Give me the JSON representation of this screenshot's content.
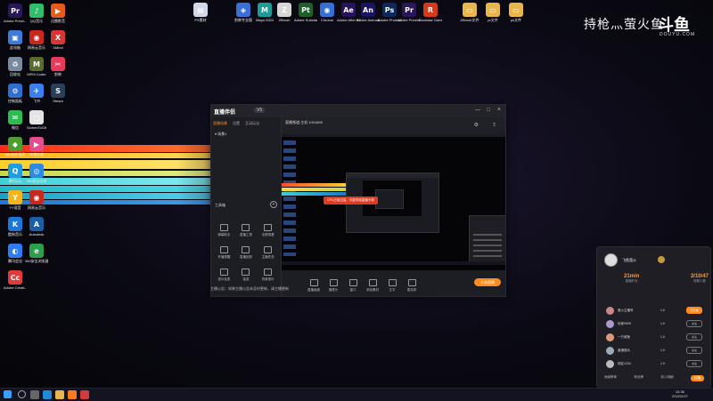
{
  "desktop_icons": [
    {
      "label": "Adobe Premi...",
      "color": "#2a1757",
      "glyph": "Pr"
    },
    {
      "label": "QQ音乐",
      "color": "#2fbf6a",
      "glyph": "♪"
    },
    {
      "label": "迅雷影音",
      "color": "#e85a1a",
      "glyph": "▶"
    },
    {
      "label": "此电脑",
      "color": "#3e7ad8",
      "glyph": "▣"
    },
    {
      "label": "网易云音乐",
      "color": "#c9281e",
      "glyph": "◉"
    },
    {
      "label": "XMind",
      "color": "#d83535",
      "glyph": "X"
    },
    {
      "label": "回收站",
      "color": "#7a8aa0",
      "glyph": "♻"
    },
    {
      "label": "MPM Coder",
      "color": "#5a6b2f",
      "glyph": "M"
    },
    {
      "label": "剪映",
      "color": "#e53a5c",
      "glyph": "✂"
    },
    {
      "label": "控制面板",
      "color": "#2f6fd1",
      "glyph": "⚙"
    },
    {
      "label": "飞书",
      "color": "#3a7ff0",
      "glyph": "✈"
    },
    {
      "label": "Steam",
      "color": "#2a3f5a",
      "glyph": "S"
    },
    {
      "label": "微信",
      "color": "#2bbd4f",
      "glyph": "✉"
    },
    {
      "label": "ScreenToGif",
      "color": "#e4e4e4",
      "glyph": "▢"
    },
    {
      "label": "360安全卫士",
      "color": "#3ba852",
      "glyph": "◈"
    },
    {
      "label": "360软件管家",
      "color": "#4b9f2f",
      "glyph": "◆"
    },
    {
      "label": "哔哩哔哩",
      "color": "#e54d8f",
      "glyph": "▶"
    },
    {
      "label": "斗鱼直播伴侣",
      "color": "#ff7a1a",
      "glyph": "鱼"
    },
    {
      "label": "腾讯QQ",
      "color": "#1f9de0",
      "glyph": "Q"
    },
    {
      "label": "360驱动大师",
      "color": "#2c8ae0",
      "glyph": "◎"
    },
    {
      "label": "微信",
      "color": "#2bbd4f",
      "glyph": "✉"
    },
    {
      "label": "YY语音",
      "color": "#f2b51c",
      "glyph": "Y"
    },
    {
      "label": "网易云音乐",
      "color": "#c9281e",
      "glyph": "◉"
    },
    {
      "label": "360浏览器",
      "color": "#2b9f49",
      "glyph": "e"
    },
    {
      "label": "酷狗音乐",
      "color": "#1a76d8",
      "glyph": "K"
    },
    {
      "label": "Autodesk",
      "color": "#1b5ea8",
      "glyph": "A"
    },
    {
      "label": "爱奇艺",
      "color": "#1ec145",
      "glyph": "i"
    },
    {
      "label": "腾讯会议",
      "color": "#2c7ef2",
      "glyph": "◐"
    },
    {
      "label": "360安全浏览器",
      "color": "#2b9f49",
      "glyph": "e"
    },
    {
      "label": "百度网盘",
      "color": "#3b7ff2",
      "glyph": "☁"
    },
    {
      "label": "Adobe Creati...",
      "color": "#e03b3b",
      "glyph": "Cc"
    }
  ],
  "top_icons": [
    {
      "label": "PS素材",
      "color": "#d0d8ea",
      "glyph": "▤"
    },
    {
      "label": "剪映专业版",
      "color": "#3a6fd6",
      "glyph": "◈"
    },
    {
      "label": "Maya 2020",
      "color": "#1c9d9a",
      "glyph": "M"
    },
    {
      "label": "ZBrush",
      "color": "#d6d6d6",
      "glyph": "Z"
    },
    {
      "label": "Adobe Substance",
      "color": "#1f5f2a",
      "glyph": "Pt"
    },
    {
      "label": "Chrome",
      "color": "#3570d8",
      "glyph": "◉"
    },
    {
      "label": "Adobe After Effects",
      "color": "#26135e",
      "glyph": "Ae"
    },
    {
      "label": "Adobe Animate",
      "color": "#1b1464",
      "glyph": "An"
    },
    {
      "label": "Adobe Photoshop",
      "color": "#0b2a59",
      "glyph": "Ps"
    },
    {
      "label": "Adobe Premiere",
      "color": "#2a1757",
      "glyph": "Pr"
    },
    {
      "label": "Rockstar Games",
      "color": "#d43a1a",
      "glyph": "R"
    },
    {
      "label": "ZBrush文件",
      "color": "#e8b64a",
      "glyph": "▭"
    },
    {
      "label": "pr文件",
      "color": "#e8b64a",
      "glyph": "▭"
    },
    {
      "label": "ps文件",
      "color": "#e8b64a",
      "glyph": "▭"
    }
  ],
  "watermark": {
    "title": "持枪灬萤火鱼",
    "logo": "斗鱼",
    "site": "DOUYU.COM"
  },
  "app": {
    "logo": "直播伴侣",
    "version": "V5",
    "tabs": [
      "直播场景",
      "设置",
      "互动玩法"
    ],
    "scene": "场景1",
    "tool_header": "工具箱",
    "tools": [
      "弹幕助手",
      "直播工具",
      "全屏观看",
      "开播提醒",
      "直播回放",
      "主播任务",
      "观众连麦",
      "抽奖",
      "背景音乐"
    ],
    "toolbar_title": "直播频道:主机 1001855",
    "bottom_buttons": [
      "直播画面",
      "摄像头",
      "窗口",
      "添加素材",
      "文字",
      "麦克风"
    ],
    "start_button": "开始直播",
    "status_text": "主播公告：如果主播公告未及时更新，请主播更新",
    "tooltip": "CPU占用过高，可能导致直播卡顿"
  },
  "panel": {
    "name": "飞鱼萤火",
    "stats": [
      {
        "value": "21min",
        "key": "直播时长"
      },
      {
        "value": "2/10/47",
        "key": "观看人数"
      }
    ],
    "rows": [
      {
        "name": "萤火主播号",
        "value": "1.0",
        "btn": "已开播",
        "hot": true
      },
      {
        "name": "玩家9999",
        "value": "1.0",
        "btn": "关注",
        "hot": false
      },
      {
        "name": "一只咸鱼",
        "value": "1.0",
        "btn": "关注",
        "hot": false
      },
      {
        "name": "普通观众",
        "value": "1.0",
        "btn": "关注",
        "hot": false
      },
      {
        "name": "网友1234",
        "value": "1.0",
        "btn": "关注",
        "hot": false
      }
    ],
    "footer": [
      "贡献榜单",
      "粉丝榜",
      "收入明细",
      "续播"
    ]
  },
  "taskbar": {
    "time": "15:36",
    "date": "2022/2/27"
  }
}
